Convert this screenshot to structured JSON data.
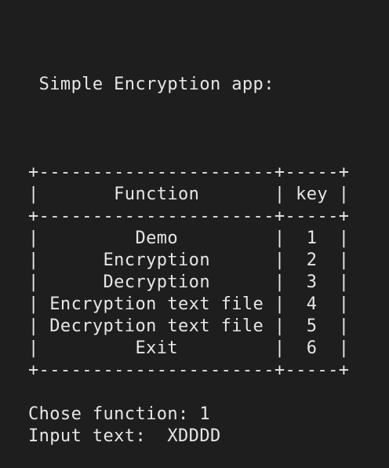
{
  "terminal": {
    "app_title": " Simple Encryption app:",
    "table_lines": [
      "+----------------------+-----+",
      "|       Function       | key |",
      "+----------------------+-----+",
      "|         Demo         |  1  |",
      "|      Encryption      |  2  |",
      "|      Decryption      |  3  |",
      "| Encryption text file |  4  |",
      "| Decryption text file |  5  |",
      "|         Exit         |  6  |",
      "+----------------------+-----+"
    ],
    "prompt_function": "Chose function: 1",
    "prompt_input": "Input text:  XDDDD"
  }
}
